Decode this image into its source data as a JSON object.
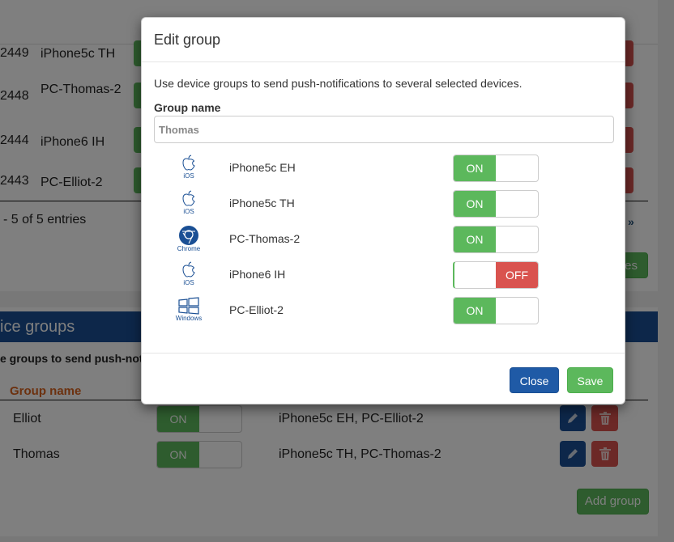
{
  "background": {
    "devices_table": {
      "rows": [
        {
          "id": "2449",
          "name": "iPhone5c TH"
        },
        {
          "id": "2448",
          "name": "PC-Thomas-2"
        },
        {
          "id": "2444",
          "name": "iPhone6 IH"
        },
        {
          "id": "2443",
          "name": "PC-Elliot-2"
        }
      ],
      "entries_info": "- 5 of 5 entries",
      "pager_next": "»",
      "save_button_fragment": "es"
    },
    "groups_panel": {
      "title": "ice groups",
      "description": "e groups to send push-notifications to several selected devices.",
      "column_group_name": "Group name",
      "rows": [
        {
          "name": "Elliot",
          "toggle": "ON",
          "devices": "iPhone5c EH, PC-Elliot-2"
        },
        {
          "name": "Thomas",
          "toggle": "ON",
          "devices": "iPhone5c TH, PC-Thomas-2"
        }
      ],
      "add_group_label": "Add group"
    }
  },
  "modal": {
    "title": "Edit group",
    "description": "Use device groups to send push-notifications to several selected devices.",
    "group_name_label": "Group name",
    "group_name_value": "Thomas",
    "devices": [
      {
        "platform": "iOS",
        "icon": "apple-icon",
        "name": "iPhone5c EH",
        "state": "ON"
      },
      {
        "platform": "iOS",
        "icon": "apple-icon",
        "name": "iPhone5c TH",
        "state": "ON"
      },
      {
        "platform": "Chrome",
        "icon": "chrome-icon",
        "name": "PC-Thomas-2",
        "state": "ON"
      },
      {
        "platform": "iOS",
        "icon": "apple-icon",
        "name": "iPhone6 IH",
        "state": "OFF"
      },
      {
        "platform": "Windows",
        "icon": "windows-icon",
        "name": "PC-Elliot-2",
        "state": "ON"
      }
    ],
    "close_label": "Close",
    "save_label": "Save"
  },
  "colors": {
    "on": "#5cb85c",
    "off": "#d9534f",
    "primary": "#1f5aa6",
    "header_blue": "#1a4f94",
    "accent_orange": "#d9631e"
  }
}
